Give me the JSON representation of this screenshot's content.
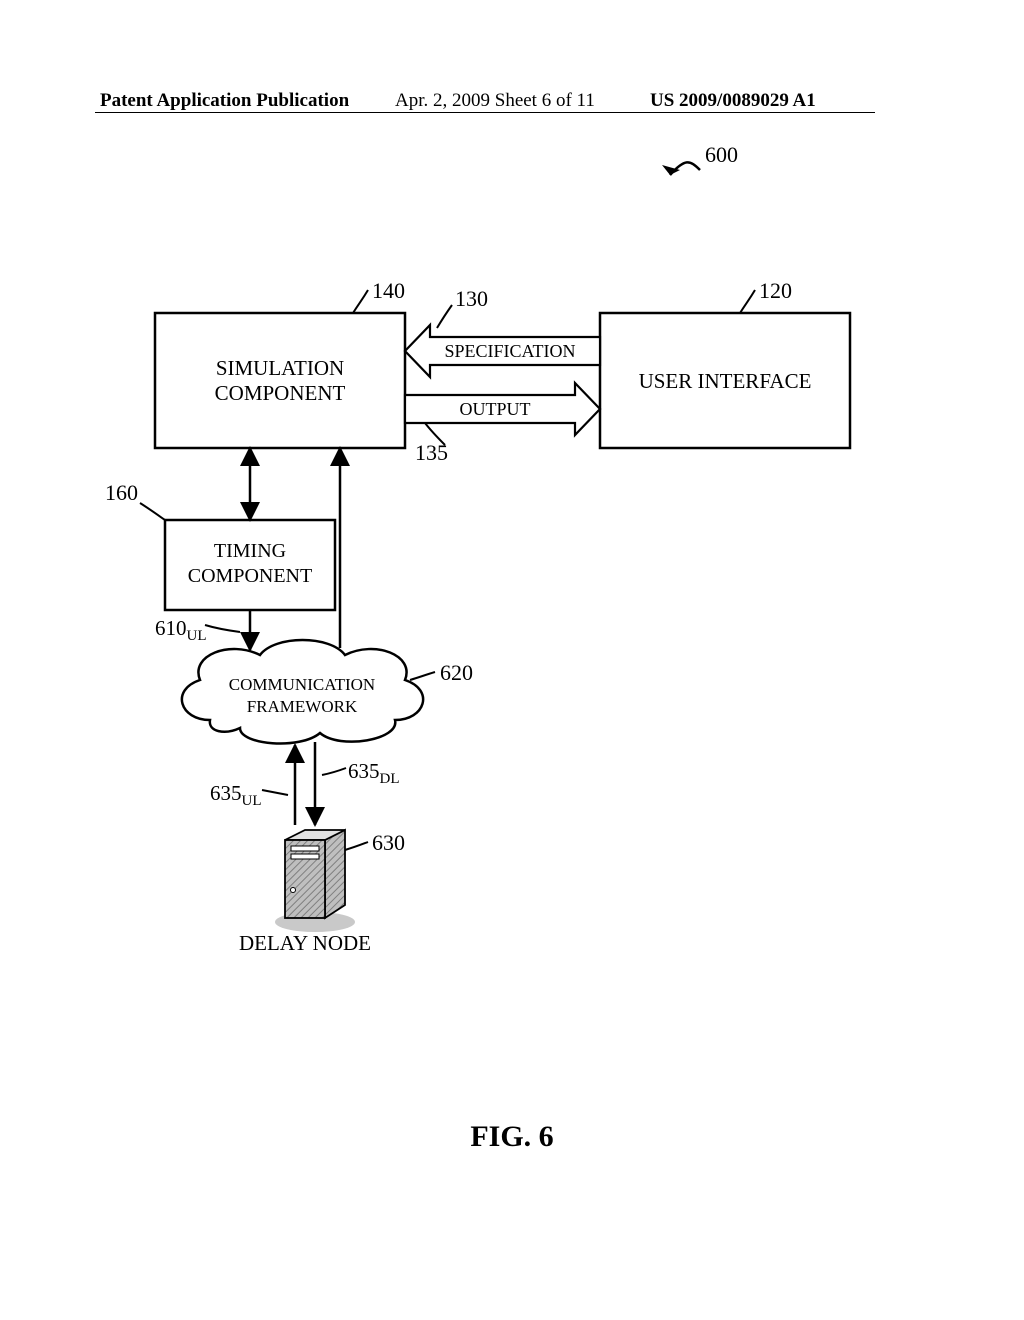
{
  "header": {
    "left": "Patent Application Publication",
    "center": "Apr. 2, 2009  Sheet 6 of 11",
    "right": "US 2009/0089029 A1"
  },
  "figure_caption": "FIG. 6",
  "diagram": {
    "ref_top": "600",
    "box140": {
      "label": "SIMULATION\nCOMPONENT",
      "ref": "140"
    },
    "box120": {
      "label": "USER INTERFACE",
      "ref": "120"
    },
    "arrow_spec": {
      "label": "SPECIFICATION",
      "ref": "130"
    },
    "arrow_out": {
      "label": "OUTPUT",
      "ref": "135"
    },
    "box_timing": {
      "label": "TIMING\nCOMPONENT",
      "ref": "160"
    },
    "cloud": {
      "label": "COMMUNICATION\nFRAMEWORK",
      "ref": "620"
    },
    "delay_node": {
      "label": "DELAY NODE",
      "ref": "630"
    },
    "ref_610UL": "610",
    "ref_610UL_sub": "UL",
    "ref_635UL": "635",
    "ref_635UL_sub": "UL",
    "ref_635DL": "635",
    "ref_635DL_sub": "DL"
  },
  "chart_data": {
    "type": "diagram",
    "title": "FIG. 6 — System 600 block diagram",
    "nodes": [
      {
        "id": "140",
        "label": "SIMULATION COMPONENT",
        "kind": "box"
      },
      {
        "id": "120",
        "label": "USER INTERFACE",
        "kind": "box"
      },
      {
        "id": "160",
        "label": "TIMING COMPONENT",
        "kind": "box"
      },
      {
        "id": "620",
        "label": "COMMUNICATION FRAMEWORK",
        "kind": "cloud"
      },
      {
        "id": "630",
        "label": "DELAY NODE",
        "kind": "server"
      }
    ],
    "edges": [
      {
        "from": "120",
        "to": "140",
        "label": "SPECIFICATION",
        "ref": "130",
        "dir": "uni"
      },
      {
        "from": "140",
        "to": "120",
        "label": "OUTPUT",
        "ref": "135",
        "dir": "uni"
      },
      {
        "from": "140",
        "to": "160",
        "ref": "",
        "dir": "bi"
      },
      {
        "from": "160",
        "to": "620",
        "ref": "610UL",
        "dir": "uni"
      },
      {
        "from": "620",
        "to": "140",
        "ref": "",
        "dir": "uni"
      },
      {
        "from": "630",
        "to": "620",
        "ref": "635UL",
        "dir": "uni"
      },
      {
        "from": "620",
        "to": "630",
        "ref": "635DL",
        "dir": "uni"
      }
    ],
    "overall_ref": "600"
  }
}
